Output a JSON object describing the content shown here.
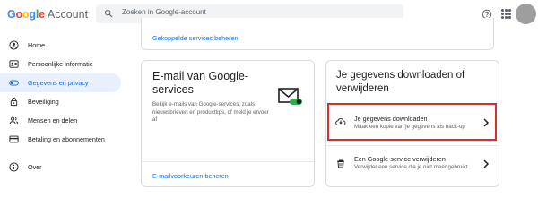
{
  "header": {
    "logo_google": "Google",
    "logo_account": "Account",
    "search_placeholder": "Zoeken in Google-account",
    "icons": [
      "search-icon",
      "help-icon",
      "apps-grid-icon",
      "avatar"
    ]
  },
  "sidebar": {
    "items": [
      {
        "label": "Home",
        "icon": "person-circle-icon",
        "active": false
      },
      {
        "label": "Persoonlijke informatie",
        "icon": "id-card-icon",
        "active": false
      },
      {
        "label": "Gegevens en privacy",
        "icon": "toggle-icon",
        "active": true
      },
      {
        "label": "Beveiliging",
        "icon": "lock-icon",
        "active": false
      },
      {
        "label": "Mensen en delen",
        "icon": "people-icon",
        "active": false
      },
      {
        "label": "Betaling en abonnementen",
        "icon": "credit-card-icon",
        "active": false
      },
      {
        "label": "Over",
        "icon": "info-icon",
        "active": false
      }
    ]
  },
  "cards": {
    "top": {
      "link": "Gekoppelde services beheren"
    },
    "email": {
      "title": "E-mail van Google-services",
      "description": "Bekijk e-mails van Google-services, zoals nieuwsbrieven en producttips, of meld je ervoor af",
      "link": "E-mailvoorkeuren beheren"
    },
    "download": {
      "title": "Je gegevens downloaden of verwijderen",
      "rows": [
        {
          "title": "Je gegevens downloaden",
          "description": "Maak een kopie van je gegevens als back-up",
          "icon": "cloud-download-icon",
          "highlighted": true
        },
        {
          "title": "Een Google-service verwijderen",
          "description": "Verwijder een service die je niet meer gebruikt",
          "icon": "trash-icon",
          "highlighted": false
        }
      ]
    }
  },
  "colors": {
    "accent": "#1a73e8",
    "active_nav_bg": "#e8f0fe",
    "highlight_border": "#d32f2f",
    "toggle_green": "#34a853"
  }
}
